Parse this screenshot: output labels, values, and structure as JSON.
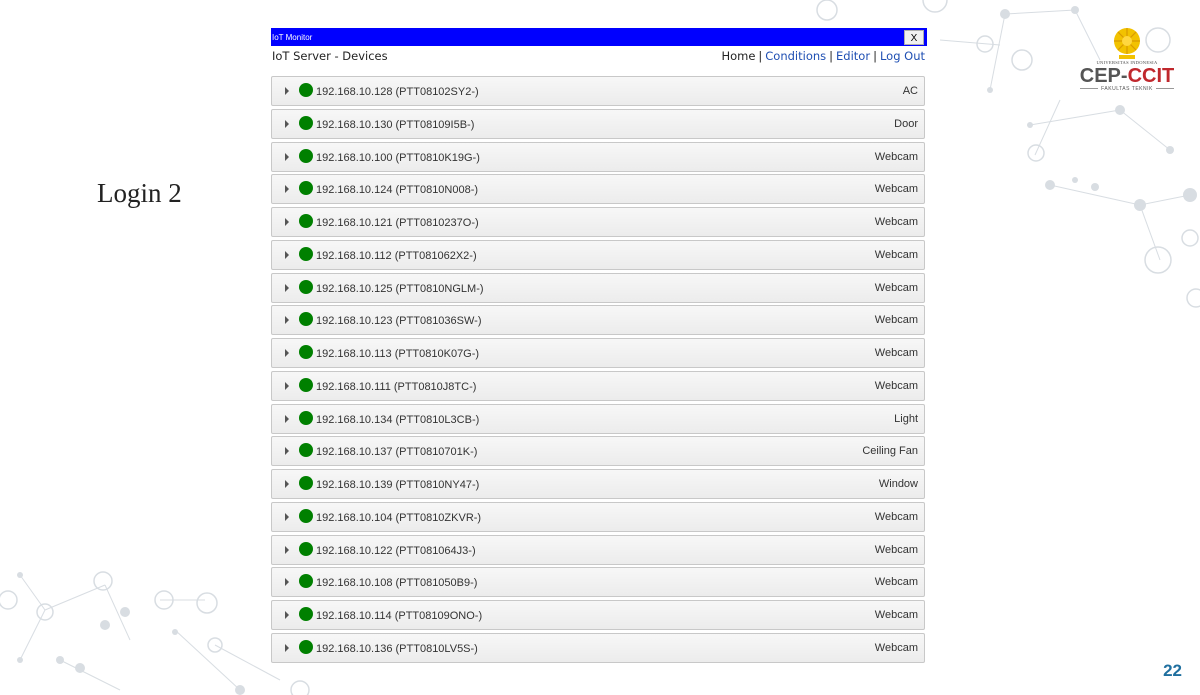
{
  "slide": {
    "title": "Login 2",
    "page_number": "22"
  },
  "logo": {
    "university": "UNIVERSITAS INDONESIA",
    "name_part1": "CEP-",
    "name_part2": "CCIT",
    "subtitle": "FAKULTAS TEKNIK"
  },
  "window": {
    "title": "IoT Monitor",
    "close_label": "X",
    "header": "IoT Server - Devices",
    "nav": {
      "home": "Home",
      "conditions": "Conditions",
      "editor": "Editor",
      "logout": "Log Out"
    }
  },
  "devices": [
    {
      "name": "192.168.10.128 (PTT08102SY2-)",
      "type": "AC"
    },
    {
      "name": "192.168.10.130 (PTT08109I5B-)",
      "type": "Door"
    },
    {
      "name": "192.168.10.100 (PTT0810K19G-)",
      "type": "Webcam"
    },
    {
      "name": "192.168.10.124 (PTT0810N008-)",
      "type": "Webcam"
    },
    {
      "name": "192.168.10.121 (PTT0810237O-)",
      "type": "Webcam"
    },
    {
      "name": "192.168.10.112 (PTT081062X2-)",
      "type": "Webcam"
    },
    {
      "name": "192.168.10.125 (PTT0810NGLM-)",
      "type": "Webcam"
    },
    {
      "name": "192.168.10.123 (PTT081036SW-)",
      "type": "Webcam"
    },
    {
      "name": "192.168.10.113 (PTT0810K07G-)",
      "type": "Webcam"
    },
    {
      "name": "192.168.10.111 (PTT0810J8TC-)",
      "type": "Webcam"
    },
    {
      "name": "192.168.10.134 (PTT0810L3CB-)",
      "type": "Light"
    },
    {
      "name": "192.168.10.137 (PTT0810701K-)",
      "type": "Ceiling Fan"
    },
    {
      "name": "192.168.10.139 (PTT0810NY47-)",
      "type": "Window"
    },
    {
      "name": "192.168.10.104 (PTT0810ZKVR-)",
      "type": "Webcam"
    },
    {
      "name": "192.168.10.122 (PTT081064J3-)",
      "type": "Webcam"
    },
    {
      "name": "192.168.10.108 (PTT081050B9-)",
      "type": "Webcam"
    },
    {
      "name": "192.168.10.114 (PTT08109ONO-)",
      "type": "Webcam"
    },
    {
      "name": "192.168.10.136 (PTT0810LV5S-)",
      "type": "Webcam"
    }
  ],
  "colors": {
    "titlebar": "#0000ff",
    "status_online": "#008000",
    "link": "#1f4fb3",
    "page_number": "#1f6f9f"
  }
}
